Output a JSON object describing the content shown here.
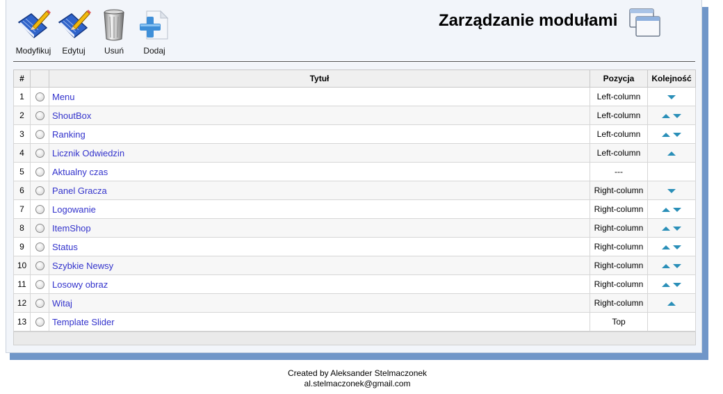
{
  "toolbar": {
    "modify_label": "Modyfikuj",
    "edit_label": "Edytuj",
    "delete_label": "Usuń",
    "add_label": "Dodaj"
  },
  "header": {
    "title": "Zarządzanie modułami"
  },
  "table": {
    "columns": {
      "num": "#",
      "select": "",
      "title": "Tytuł",
      "position": "Pozycja",
      "order": "Kolejność"
    },
    "rows": [
      {
        "num": "1",
        "title": "Menu",
        "position": "Left-column",
        "up": false,
        "down": true
      },
      {
        "num": "2",
        "title": "ShoutBox",
        "position": "Left-column",
        "up": true,
        "down": true
      },
      {
        "num": "3",
        "title": "Ranking",
        "position": "Left-column",
        "up": true,
        "down": true
      },
      {
        "num": "4",
        "title": "Licznik Odwiedzin",
        "position": "Left-column",
        "up": true,
        "down": false
      },
      {
        "num": "5",
        "title": "Aktualny czas",
        "position": "---",
        "up": false,
        "down": false
      },
      {
        "num": "6",
        "title": "Panel Gracza",
        "position": "Right-column",
        "up": false,
        "down": true
      },
      {
        "num": "7",
        "title": "Logowanie",
        "position": "Right-column",
        "up": true,
        "down": true
      },
      {
        "num": "8",
        "title": "ItemShop",
        "position": "Right-column",
        "up": true,
        "down": true
      },
      {
        "num": "9",
        "title": "Status",
        "position": "Right-column",
        "up": true,
        "down": true
      },
      {
        "num": "10",
        "title": "Szybkie Newsy",
        "position": "Right-column",
        "up": true,
        "down": true
      },
      {
        "num": "11",
        "title": "Losowy obraz",
        "position": "Right-column",
        "up": true,
        "down": true
      },
      {
        "num": "12",
        "title": "Witaj",
        "position": "Right-column",
        "up": true,
        "down": false
      },
      {
        "num": "13",
        "title": "Template Slider",
        "position": "Top",
        "up": false,
        "down": false
      }
    ]
  },
  "footer": {
    "author": "Created by Aleksander Stelmaczonek",
    "email": "al.stelmaczonek@gmail.com"
  },
  "colors": {
    "link": "#3333cc",
    "arrow": "#2a8fb8",
    "shadow": "#7096c8"
  },
  "icons": {
    "modify": "book-pencil-icon",
    "edit": "book-pencil-icon",
    "delete": "trash-can-icon",
    "add": "plus-icon",
    "title": "windows-icon"
  }
}
